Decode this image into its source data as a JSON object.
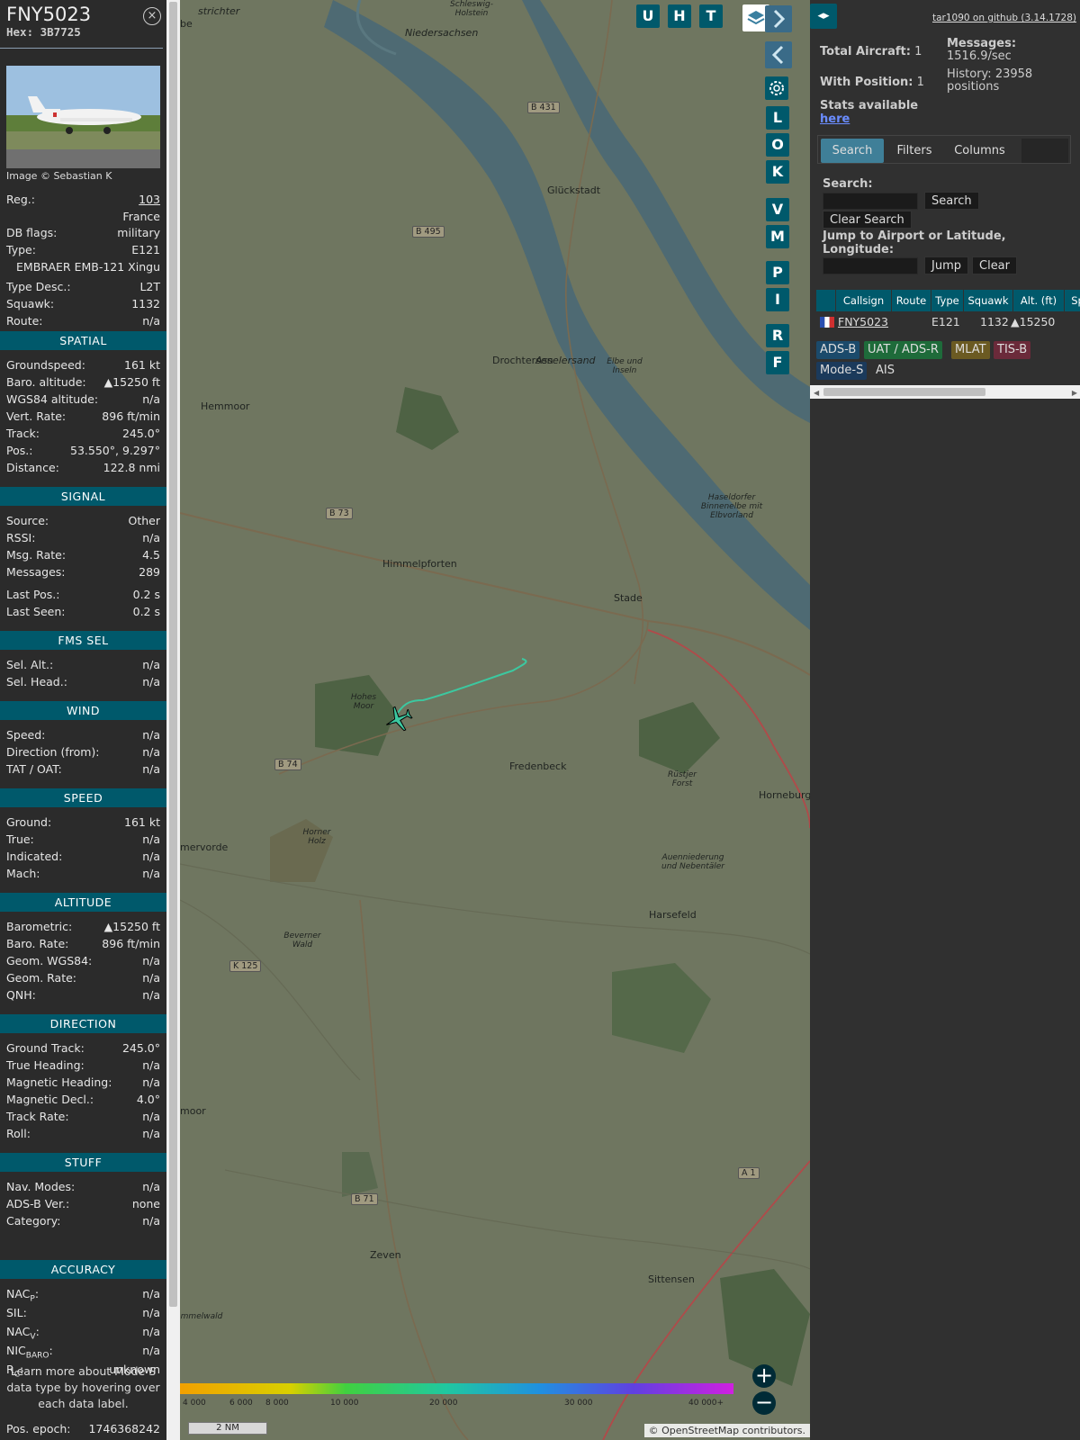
{
  "info": {
    "callsign": "FNY5023",
    "hex": "Hex: 3B7725",
    "close_icon": "×",
    "photo_credit": "Image © Sebastian K",
    "rows": [
      {
        "label": "Reg.:",
        "value": "103"
      },
      {
        "label": "",
        "value": "France"
      },
      {
        "label": "DB flags:",
        "value": "military"
      },
      {
        "label": "Type:",
        "value": "E121"
      },
      {
        "label": "",
        "value": "EMBRAER EMB-121 Xingu"
      },
      {
        "label": "Type Desc.:",
        "value": "L2T"
      },
      {
        "label": "Squawk:",
        "value": "1132"
      },
      {
        "label": "Route:",
        "value": "n/a"
      }
    ],
    "sections": [
      {
        "title": "SPATIAL",
        "rows": [
          {
            "label": "Groundspeed:",
            "value": "161 kt"
          },
          {
            "label": "Baro. altitude:",
            "value": "▲15250 ft"
          },
          {
            "label": "WGS84 altitude:",
            "value": "n/a"
          },
          {
            "label": "Vert. Rate:",
            "value": "896 ft/min"
          },
          {
            "label": "Track:",
            "value": "245.0°"
          },
          {
            "label": "Pos.:",
            "value": "53.550°, 9.297°"
          },
          {
            "label": "Distance:",
            "value": "122.8 nmi"
          }
        ]
      },
      {
        "title": "SIGNAL",
        "rows": [
          {
            "label": "Source:",
            "value": "Other"
          },
          {
            "label": "RSSI:",
            "value": "n/a"
          },
          {
            "label": "Msg. Rate:",
            "value": "4.5"
          },
          {
            "label": "Messages:",
            "value": "289"
          },
          {
            "label": "Last Pos.:",
            "value": "0.2 s"
          },
          {
            "label": "Last Seen:",
            "value": "0.2 s"
          }
        ]
      },
      {
        "title": "FMS SEL",
        "rows": [
          {
            "label": "Sel. Alt.:",
            "value": "n/a"
          },
          {
            "label": "Sel. Head.:",
            "value": "n/a"
          }
        ]
      },
      {
        "title": "WIND",
        "rows": [
          {
            "label": "Speed:",
            "value": "n/a"
          },
          {
            "label": "Direction (from):",
            "value": "n/a"
          },
          {
            "label": "TAT / OAT:",
            "value": "n/a"
          }
        ]
      },
      {
        "title": "SPEED",
        "rows": [
          {
            "label": "Ground:",
            "value": "161 kt"
          },
          {
            "label": "True:",
            "value": "n/a"
          },
          {
            "label": "Indicated:",
            "value": "n/a"
          },
          {
            "label": "Mach:",
            "value": "n/a"
          }
        ]
      },
      {
        "title": "ALTITUDE",
        "rows": [
          {
            "label": "Barometric:",
            "value": "▲15250 ft"
          },
          {
            "label": "Baro. Rate:",
            "value": "896 ft/min"
          },
          {
            "label": "Geom. WGS84:",
            "value": "n/a"
          },
          {
            "label": "Geom. Rate:",
            "value": "n/a"
          },
          {
            "label": "QNH:",
            "value": "n/a"
          }
        ]
      },
      {
        "title": "DIRECTION",
        "rows": [
          {
            "label": "Ground Track:",
            "value": "245.0°"
          },
          {
            "label": "True Heading:",
            "value": "n/a"
          },
          {
            "label": "Magnetic Heading:",
            "value": "n/a"
          },
          {
            "label": "Magnetic Decl.:",
            "value": "4.0°"
          },
          {
            "label": "Track Rate:",
            "value": "n/a"
          },
          {
            "label": "Roll:",
            "value": "n/a"
          }
        ]
      },
      {
        "title": "STUFF",
        "rows": [
          {
            "label": "Nav. Modes:",
            "value": "n/a"
          },
          {
            "label": "ADS-B Ver.:",
            "value": "none"
          },
          {
            "label": "Category:",
            "value": "n/a"
          }
        ]
      },
      {
        "title": "ACCURACY",
        "rows": [
          {
            "label": "NACP:",
            "value": "n/a"
          },
          {
            "label": "SIL:",
            "value": "n/a"
          },
          {
            "label": "NACV:",
            "value": "n/a"
          },
          {
            "label": "NICBARO:",
            "value": "n/a"
          },
          {
            "label": "RC:",
            "value": "unknown"
          }
        ]
      }
    ],
    "learn_more": "Learn more about Mode S data type by hovering over each data label.",
    "pos_epoch_label": "Pos. epoch:",
    "pos_epoch_value": "1746368242"
  },
  "map": {
    "buttons": [
      "U",
      "H",
      "T"
    ],
    "side_buttons": [
      "L",
      "O",
      "K",
      "V",
      "M",
      "P",
      "I",
      "R",
      "F"
    ],
    "layers_icon": "layers-icon",
    "settings_icon": "gear-icon",
    "zoom_in": "+",
    "zoom_out": "−",
    "places": [
      "Glückstadt",
      "Drochtersen",
      "Asselersand",
      "Elbe und Inseln",
      "Hemmoor",
      "Himmelpforten",
      "Stade",
      "Hohes Moor",
      "Fredenbeck",
      "Rüstjer Forst",
      "Horneburg",
      "mervorde",
      "Horner Holz",
      "Auenniederung und Nebentäler",
      "Harsefeld",
      "Beverner Wald",
      "Zeven",
      "Sittensen",
      "Haseldorfer Binnenelbe mit Elbvorland",
      "Niedersachsen",
      "Schleswig-Holstein",
      "strichter",
      "be",
      "moor",
      "mmelwald"
    ],
    "roads": [
      "B 431",
      "B 495",
      "B 73",
      "B 74",
      "K 125",
      "B 71",
      "A 1"
    ],
    "scale_labels": [
      "4 000",
      "6 000",
      "8 000",
      "10 000",
      "20 000",
      "30 000",
      "40 000+"
    ],
    "scale_nm": "2 NM",
    "attribution": "© OpenStreetMap contributors."
  },
  "sidebar": {
    "toggle_icon": "◂▸",
    "github": "tar1090 on github (3.14.1728)",
    "total_label": "Total Aircraft:",
    "total_value": "1",
    "withpos_label": "With Position:",
    "withpos_value": "1",
    "messages_label": "Messages:",
    "messages_value": "1516.9/sec",
    "history_label": "History: 23958 positions",
    "stats_label": "Stats available",
    "stats_link": "here",
    "tabs": [
      "Search",
      "Filters",
      "Columns"
    ],
    "search_label": "Search:",
    "search_button": "Search",
    "clear_search_button": "Clear Search",
    "jump_label": "Jump to Airport or Latitude, Longitude:",
    "jump_button": "Jump",
    "clear_button": "Clear",
    "columns": [
      "",
      "Callsign",
      "Route",
      "Type",
      "Squawk",
      "Alt. (ft)",
      "Sp"
    ],
    "row": {
      "callsign": "FNY5023",
      "type": "E121",
      "squawk": "1132",
      "alt": "▲15250"
    },
    "sources": [
      "ADS-B",
      "UAT / ADS-R",
      "MLAT",
      "TIS-B",
      "Mode-S",
      "AIS"
    ]
  },
  "colors": {
    "accent": "#00596b",
    "track": "#3cc8a0",
    "adsb": "#1b4a6b",
    "uat": "#1e6b3a",
    "mlat": "#6b5a22",
    "tisb": "#6b2a3a"
  }
}
